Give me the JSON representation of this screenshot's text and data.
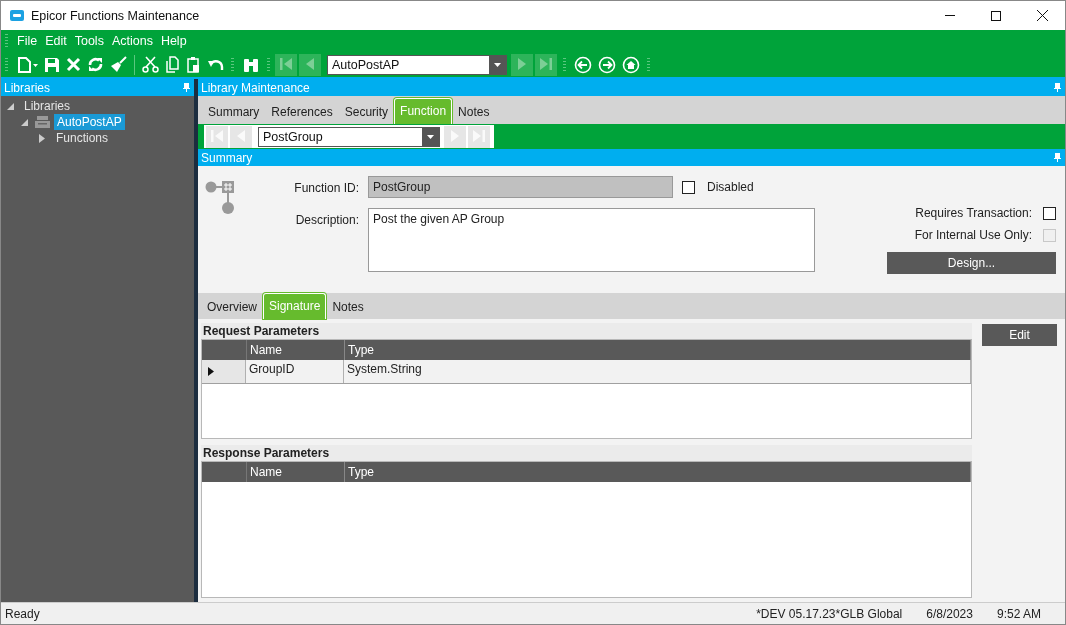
{
  "window": {
    "title": "Epicor Functions Maintenance"
  },
  "menu": [
    {
      "label": "File"
    },
    {
      "label": "Edit"
    },
    {
      "label": "Tools"
    },
    {
      "label": "Actions"
    },
    {
      "label": "Help"
    }
  ],
  "toolbar": {
    "record": {
      "value": "AutoPostAP"
    }
  },
  "libraries_panel": {
    "title": "Libraries",
    "tree": [
      {
        "label": "Libraries",
        "expanded": true,
        "selected": false,
        "children": [
          {
            "label": "AutoPostAP",
            "expanded": true,
            "selected": true,
            "children": [
              {
                "label": "Functions",
                "expanded": false,
                "selected": false
              }
            ]
          }
        ]
      }
    ]
  },
  "main_panel": {
    "title": "Library Maintenance",
    "tabs": [
      {
        "label": "Summary",
        "selected": false
      },
      {
        "label": "References",
        "selected": false
      },
      {
        "label": "Security",
        "selected": false
      },
      {
        "label": "Function",
        "selected": true
      },
      {
        "label": "Notes",
        "selected": false
      }
    ],
    "function_selector": {
      "value": "PostGroup"
    },
    "summary": {
      "title": "Summary",
      "function_id": {
        "label": "Function ID:",
        "value": "PostGroup"
      },
      "disabled": {
        "label": "Disabled",
        "checked": false
      },
      "description": {
        "label": "Description:",
        "value": "Post the given AP Group"
      },
      "requires_transaction": {
        "label": "Requires Transaction:",
        "checked": false,
        "disabled": false
      },
      "internal_use_only": {
        "label": "For Internal Use Only:",
        "checked": false,
        "disabled": true
      },
      "design_button": "Design..."
    },
    "subtabs": [
      {
        "label": "Overview",
        "selected": false
      },
      {
        "label": "Signature",
        "selected": true
      },
      {
        "label": "Notes",
        "selected": false
      }
    ],
    "request_parameters": {
      "title": "Request Parameters",
      "columns": [
        "Name",
        "Type"
      ],
      "rows": [
        {
          "cells": [
            "GroupID",
            "System.String"
          ],
          "current": true
        }
      ]
    },
    "response_parameters": {
      "title": "Response Parameters",
      "columns": [
        "Name",
        "Type"
      ]
    },
    "edit_button": "Edit"
  },
  "status_bar": {
    "message": "Ready",
    "environment": "*DEV 05.17.23*GLB Global",
    "date": "6/8/2023",
    "time": "9:52 AM"
  }
}
